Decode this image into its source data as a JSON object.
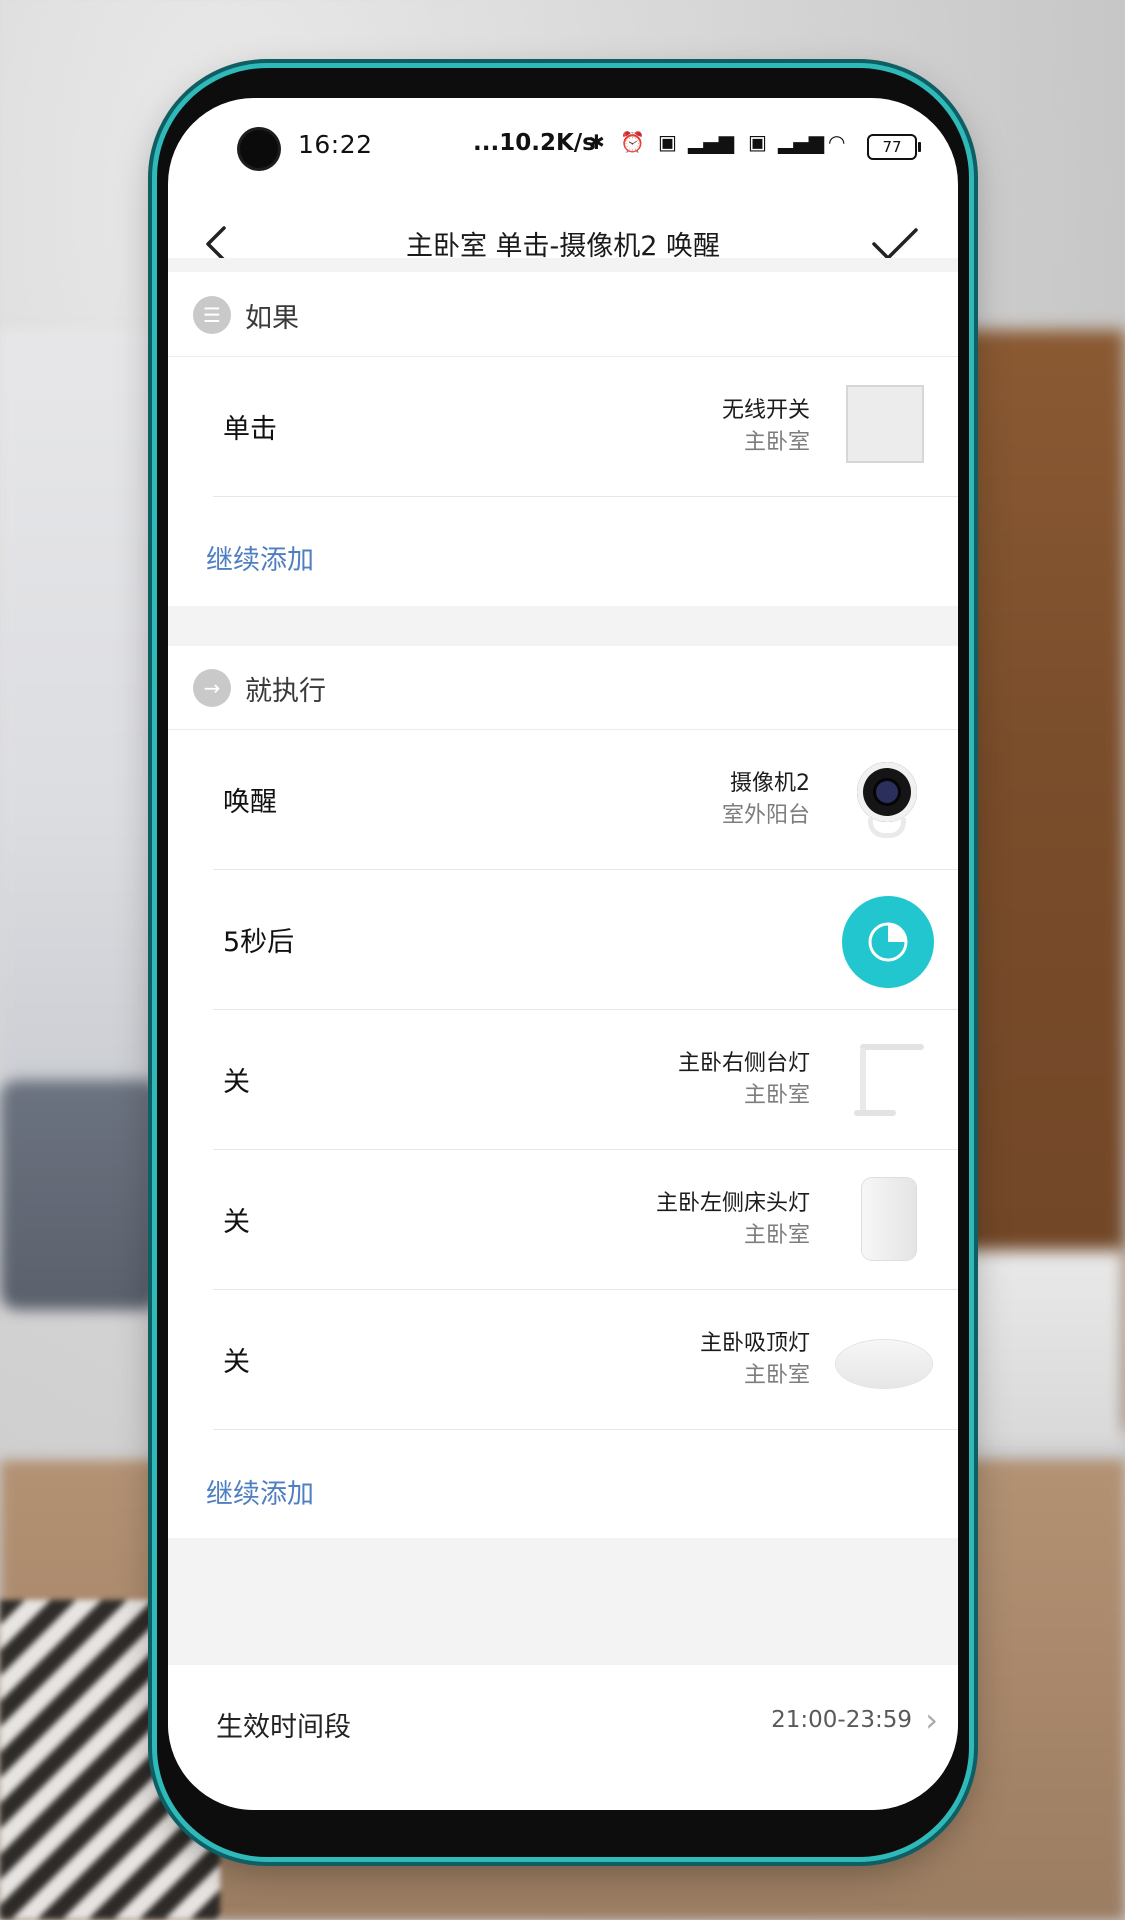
{
  "status_bar": {
    "time": "16:22",
    "net_speed": "...10.2K/s",
    "battery": "77"
  },
  "header": {
    "title": "主卧室 单击-摄像机2 唤醒",
    "back_icon": "chevron-left-icon",
    "confirm_icon": "check-icon"
  },
  "if_section": {
    "label": "如果",
    "rows": [
      {
        "action": "单击",
        "device_name": "无线开关",
        "room": "主卧室",
        "thumb": "wireless-switch"
      }
    ],
    "add_label": "继续添加"
  },
  "then_section": {
    "label": "就执行",
    "rows": [
      {
        "action": "唤醒",
        "device_name": "摄像机2",
        "room": "室外阳台",
        "thumb": "camera"
      },
      {
        "action": "5秒后",
        "device_name": "",
        "room": "",
        "thumb": "timer"
      },
      {
        "action": "关",
        "device_name": "主卧右侧台灯",
        "room": "主卧室",
        "thumb": "desk-lamp"
      },
      {
        "action": "关",
        "device_name": "主卧左侧床头灯",
        "room": "主卧室",
        "thumb": "bedside-lamp"
      },
      {
        "action": "关",
        "device_name": "主卧吸顶灯",
        "room": "主卧室",
        "thumb": "ceiling-light"
      }
    ],
    "add_label": "继续添加"
  },
  "footer": {
    "label": "生效时间段",
    "value": "21:00-23:59"
  },
  "colors": {
    "accent_blue": "#4f7fc0",
    "timer_teal": "#21c6cf",
    "phone_frame": "#2fb9b9"
  }
}
